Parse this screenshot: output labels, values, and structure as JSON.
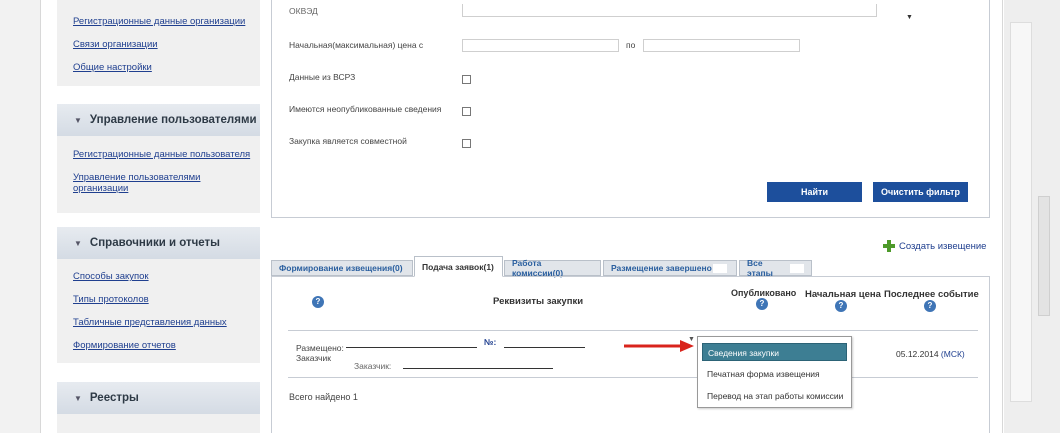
{
  "sidebar": {
    "org_links": [
      "Регистрационные данные организации",
      "Связи организации",
      "Общие настройки"
    ],
    "sections": [
      {
        "title": "Управление пользователями",
        "links": [
          "Регистрационные данные пользователя",
          "Управление пользователями организации"
        ]
      },
      {
        "title": "Справочники и отчеты",
        "links": [
          "Способы закупок",
          "Типы протоколов",
          "Табличные представления данных",
          "Формирование отчетов"
        ]
      },
      {
        "title": "Реестры",
        "links": []
      }
    ]
  },
  "filter": {
    "okved_label": "ОКВЭД",
    "price_label": "Начальная(максимальная) цена с",
    "price_to": "по",
    "vsrz_label": "Данные из ВСРЗ",
    "unpublished_label": "Имеются неопубликованные сведения",
    "joint_label": "Закупка является совместной",
    "find_button": "Найти",
    "clear_button": "Очистить фильтр"
  },
  "create_notice": "Создать извещение",
  "tabs": [
    "Формирование извещения(0)",
    "Подача заявок(1)",
    "Работа комиссии(0)",
    "Размещение завершено",
    "Все этапы"
  ],
  "columns": {
    "requisites": "Реквизиты закупки",
    "published": "Опубликовано",
    "initial_price": "Начальная цена",
    "last_event": "Последнее событие"
  },
  "row": {
    "placed": "Размещено:",
    "customer": "Заказчик",
    "number": "№:",
    "customer2": "Заказчик:",
    "event_date": "05.12.2014",
    "event_tz": "(МСК)"
  },
  "menu_items": [
    "Сведения закупки",
    "Печатная форма извещения",
    "Перевод на этап работы комиссии"
  ],
  "total": "Всего найдено 1",
  "colors": {
    "accent": "#1d4f9c",
    "menu_highlight": "#3d7e93",
    "arrow": "#d9241c",
    "link": "#1f3f8f"
  }
}
